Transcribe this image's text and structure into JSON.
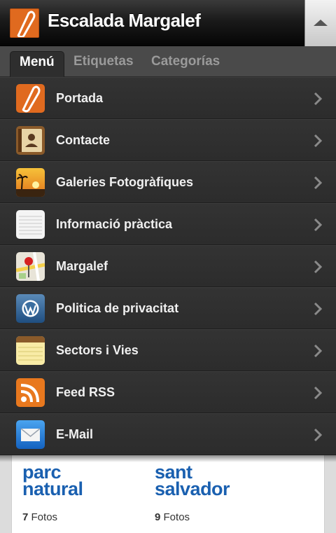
{
  "header": {
    "title": "Escalada Margalef"
  },
  "tabs": [
    {
      "label": "Menú",
      "active": true
    },
    {
      "label": "Etiquetas",
      "active": false
    },
    {
      "label": "Categorías",
      "active": false
    }
  ],
  "menu": {
    "items": [
      {
        "label": "Portada",
        "icon": "carabiner-icon"
      },
      {
        "label": "Contacte",
        "icon": "contacts-icon"
      },
      {
        "label": "Galeries Fotogràfiques",
        "icon": "sunset-photo-icon"
      },
      {
        "label": "Informació pràctica",
        "icon": "notes-page-icon"
      },
      {
        "label": "Margalef",
        "icon": "map-pin-icon"
      },
      {
        "label": "Politica de privacitat",
        "icon": "wordpress-icon"
      },
      {
        "label": "Sectors i Vies",
        "icon": "notepad-icon"
      },
      {
        "label": "Feed RSS",
        "icon": "rss-icon"
      },
      {
        "label": "E-Mail",
        "icon": "mail-icon"
      }
    ]
  },
  "gallery": {
    "cards": [
      {
        "logo_line1": "parc",
        "logo_line2": "natural",
        "count": "7",
        "count_label": "Fotos"
      },
      {
        "logo_line1": "sant",
        "logo_line2": "salvador",
        "count": "9",
        "count_label": "Fotos"
      }
    ]
  },
  "colors": {
    "accent_orange": "#e06a1f",
    "header_bg": "#111111",
    "menu_bg": "#2f2f2f",
    "logo_blue": "#1a60b0"
  }
}
